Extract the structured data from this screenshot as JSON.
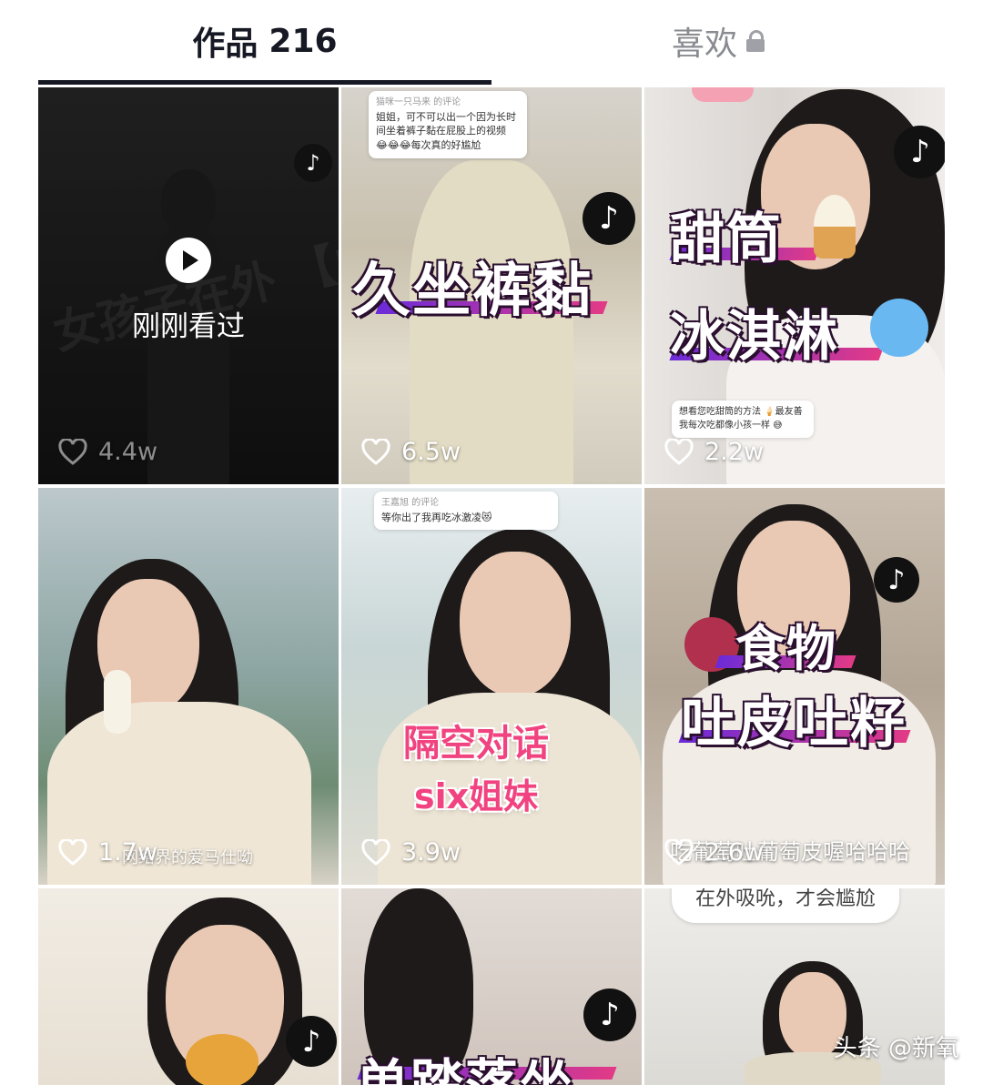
{
  "tabs": {
    "works_label": "作品",
    "works_count": "216",
    "likes_label": "喜欢"
  },
  "videos": [
    {
      "likes": "4.4w",
      "watched_label": "刚刚看过",
      "title": "女孩子在外 【內衣】"
    },
    {
      "likes": "6.5w",
      "title": "久坐裤黏",
      "comment_meta": "猫咪一只马来 的评论",
      "comment_text": "姐姐，可不可以出一个因为长时间坐着裤子黏在屁股上的视频 😂😂😂每次真的好尴尬"
    },
    {
      "likes": "2.2w",
      "title_line1": "甜筒",
      "title_line2": "冰淇淋",
      "comment_text": "想看您吃甜筒的方法 🍦最友善 我每次吃都像小孩一样 😅"
    },
    {
      "likes": "1.7w",
      "caption": "网络界的爱马仕呦"
    },
    {
      "likes": "3.9w",
      "comment_meta": "王嘉旭 的评论",
      "comment_text": "等你出了我再吃冰激凌😻",
      "title_line1": "隔空对话",
      "title_line2": "six姐妹"
    },
    {
      "likes": "2.6w",
      "title_line1": "食物",
      "title_line2": "吐皮吐籽",
      "caption": "吃葡萄吐葡萄皮喔哈哈哈"
    },
    {
      "likes": ""
    },
    {
      "likes": "",
      "title": "单踏落坐"
    },
    {
      "likes": "",
      "top_caption": "在外吸吮，才会尴尬"
    }
  ],
  "watermark": "头条 @新氧",
  "colors": {
    "accent": "#161823",
    "stripe_start": "#6b2bd9",
    "stripe_end": "#e23a86",
    "pink_title": "#f0437f"
  },
  "icons": [
    "tiktok-logo-icon",
    "heart-icon",
    "lock-icon",
    "play-icon"
  ]
}
